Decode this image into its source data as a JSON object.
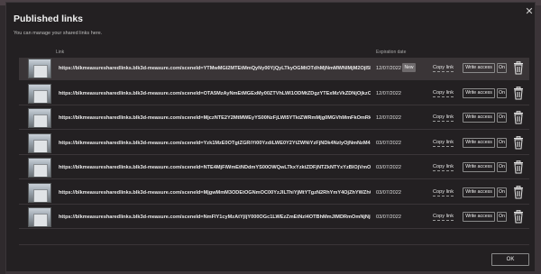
{
  "dialog": {
    "title": "Published links",
    "subtitle": "You can manage your shared links here.",
    "close_icon": "close-icon"
  },
  "table": {
    "headers": {
      "link": "Link",
      "expiration": "Expiration date"
    }
  },
  "rows": [
    {
      "link": "https://blkmeasuresharedlinks.blk3d-measure.com/sceneId=YTMwMGI2MTEtMmQyNy00YjQyLTkyOGMtOTdhMjNmMWNlMjM2OjI5NWY1NzI2...",
      "date": "12/07/2022",
      "badge": "New",
      "copy": "Copy link",
      "access": "Write access",
      "toggle": "On",
      "selected": true
    },
    {
      "link": "https://blkmeasuresharedlinks.blk3d-measure.com/sceneId=OTA5MzAyNmEtMGExMy00ZTVhLWI1ODMtZDgzYTExMzVkZDNjOjkzOWE5ZDYyOG...",
      "date": "12/07/2022",
      "badge": "",
      "copy": "Copy link",
      "access": "Write access",
      "toggle": "On",
      "selected": false
    },
    {
      "link": "https://blkmeasuresharedlinks.blk3d-measure.com/sceneId=MjczNTE2Y2MtMWEyYS00NzFjLWI5YTktZWRmMjg0MGVhMmFkOmRkZDRjYjkNjN...",
      "date": "12/07/2022",
      "badge": "",
      "copy": "Copy link",
      "access": "Write access",
      "toggle": "On",
      "selected": false
    },
    {
      "link": "https://blkmeasuresharedlinks.blk3d-measure.com/sceneId=Yzk1MzE0OTgtZGRiYi00YzdiLWE0Y2YtZWNiYzFjNDk4NzIyOjNmNzM4MTY1NTdjYjQ1...",
      "date": "03/07/2022",
      "badge": "",
      "copy": "Copy link",
      "access": "Write access",
      "toggle": "On",
      "selected": false
    },
    {
      "link": "https://blkmeasuresharedlinks.blk3d-measure.com/sceneId=NTE4MjFiWmEtNDdmYS00OWQwLTkxYzktZDFjNTZkNTYxYzBlOjVmOTcjZjNkZjZm...",
      "date": "03/07/2022",
      "badge": "",
      "copy": "Copy link",
      "access": "Write access",
      "toggle": "On",
      "selected": false
    },
    {
      "link": "https://blkmeasuresharedlinks.blk3d-measure.com/sceneId=MjgwMmM3ODEtOGNmOC00YzJlLThiYjMtYTgzN2RhYmY4OjZhYWZhOWU3O...",
      "date": "03/07/2022",
      "badge": "",
      "copy": "Copy link",
      "access": "Write access",
      "toggle": "On",
      "selected": false
    },
    {
      "link": "https://blkmeasuresharedlinks.blk3d-measure.com/sceneId=NmFlY1cyMzAtYjljY000OGc1LWEzZmEtNzI4OTBhMmJlMDRmOmNjNjRmMjkzMzlG0...",
      "date": "03/07/2022",
      "badge": "",
      "copy": "Copy link",
      "access": "Write access",
      "toggle": "On",
      "selected": false
    }
  ],
  "footer": {
    "ok_label": "OK"
  },
  "icons": {
    "trash": "trash-icon",
    "thumbnail": "scene-thumbnail"
  }
}
